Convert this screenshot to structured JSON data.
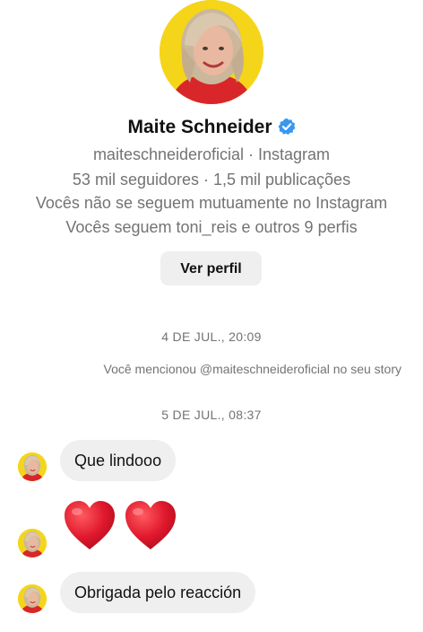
{
  "profile": {
    "name": "Maite Schneider",
    "verified_color": "#3897f0",
    "handle_line": "maiteschneideroficial · Instagram",
    "stats_line": "53 mil seguidores · 1,5 mil publicações",
    "follow_status_line": "Vocês não se seguem mutuamente no Instagram",
    "mutual_line": "Vocês seguem toni_reis e outros 9 perfis",
    "view_profile_label": "Ver perfil"
  },
  "thread": {
    "timestamp_1": "4 DE JUL., 20:09",
    "mention_note": "Você mencionou @maiteschneideroficial no seu story",
    "timestamp_2": "5 DE JUL., 08:37",
    "messages": [
      {
        "text": "Que lindooo"
      },
      {
        "emoji": "hearts",
        "count": 2
      },
      {
        "text": "Obrigada pelo reacción"
      }
    ]
  },
  "colors": {
    "bubble_bg": "#efefef",
    "avatar_bg": "#f5d51a",
    "heart": "#e0182d"
  }
}
